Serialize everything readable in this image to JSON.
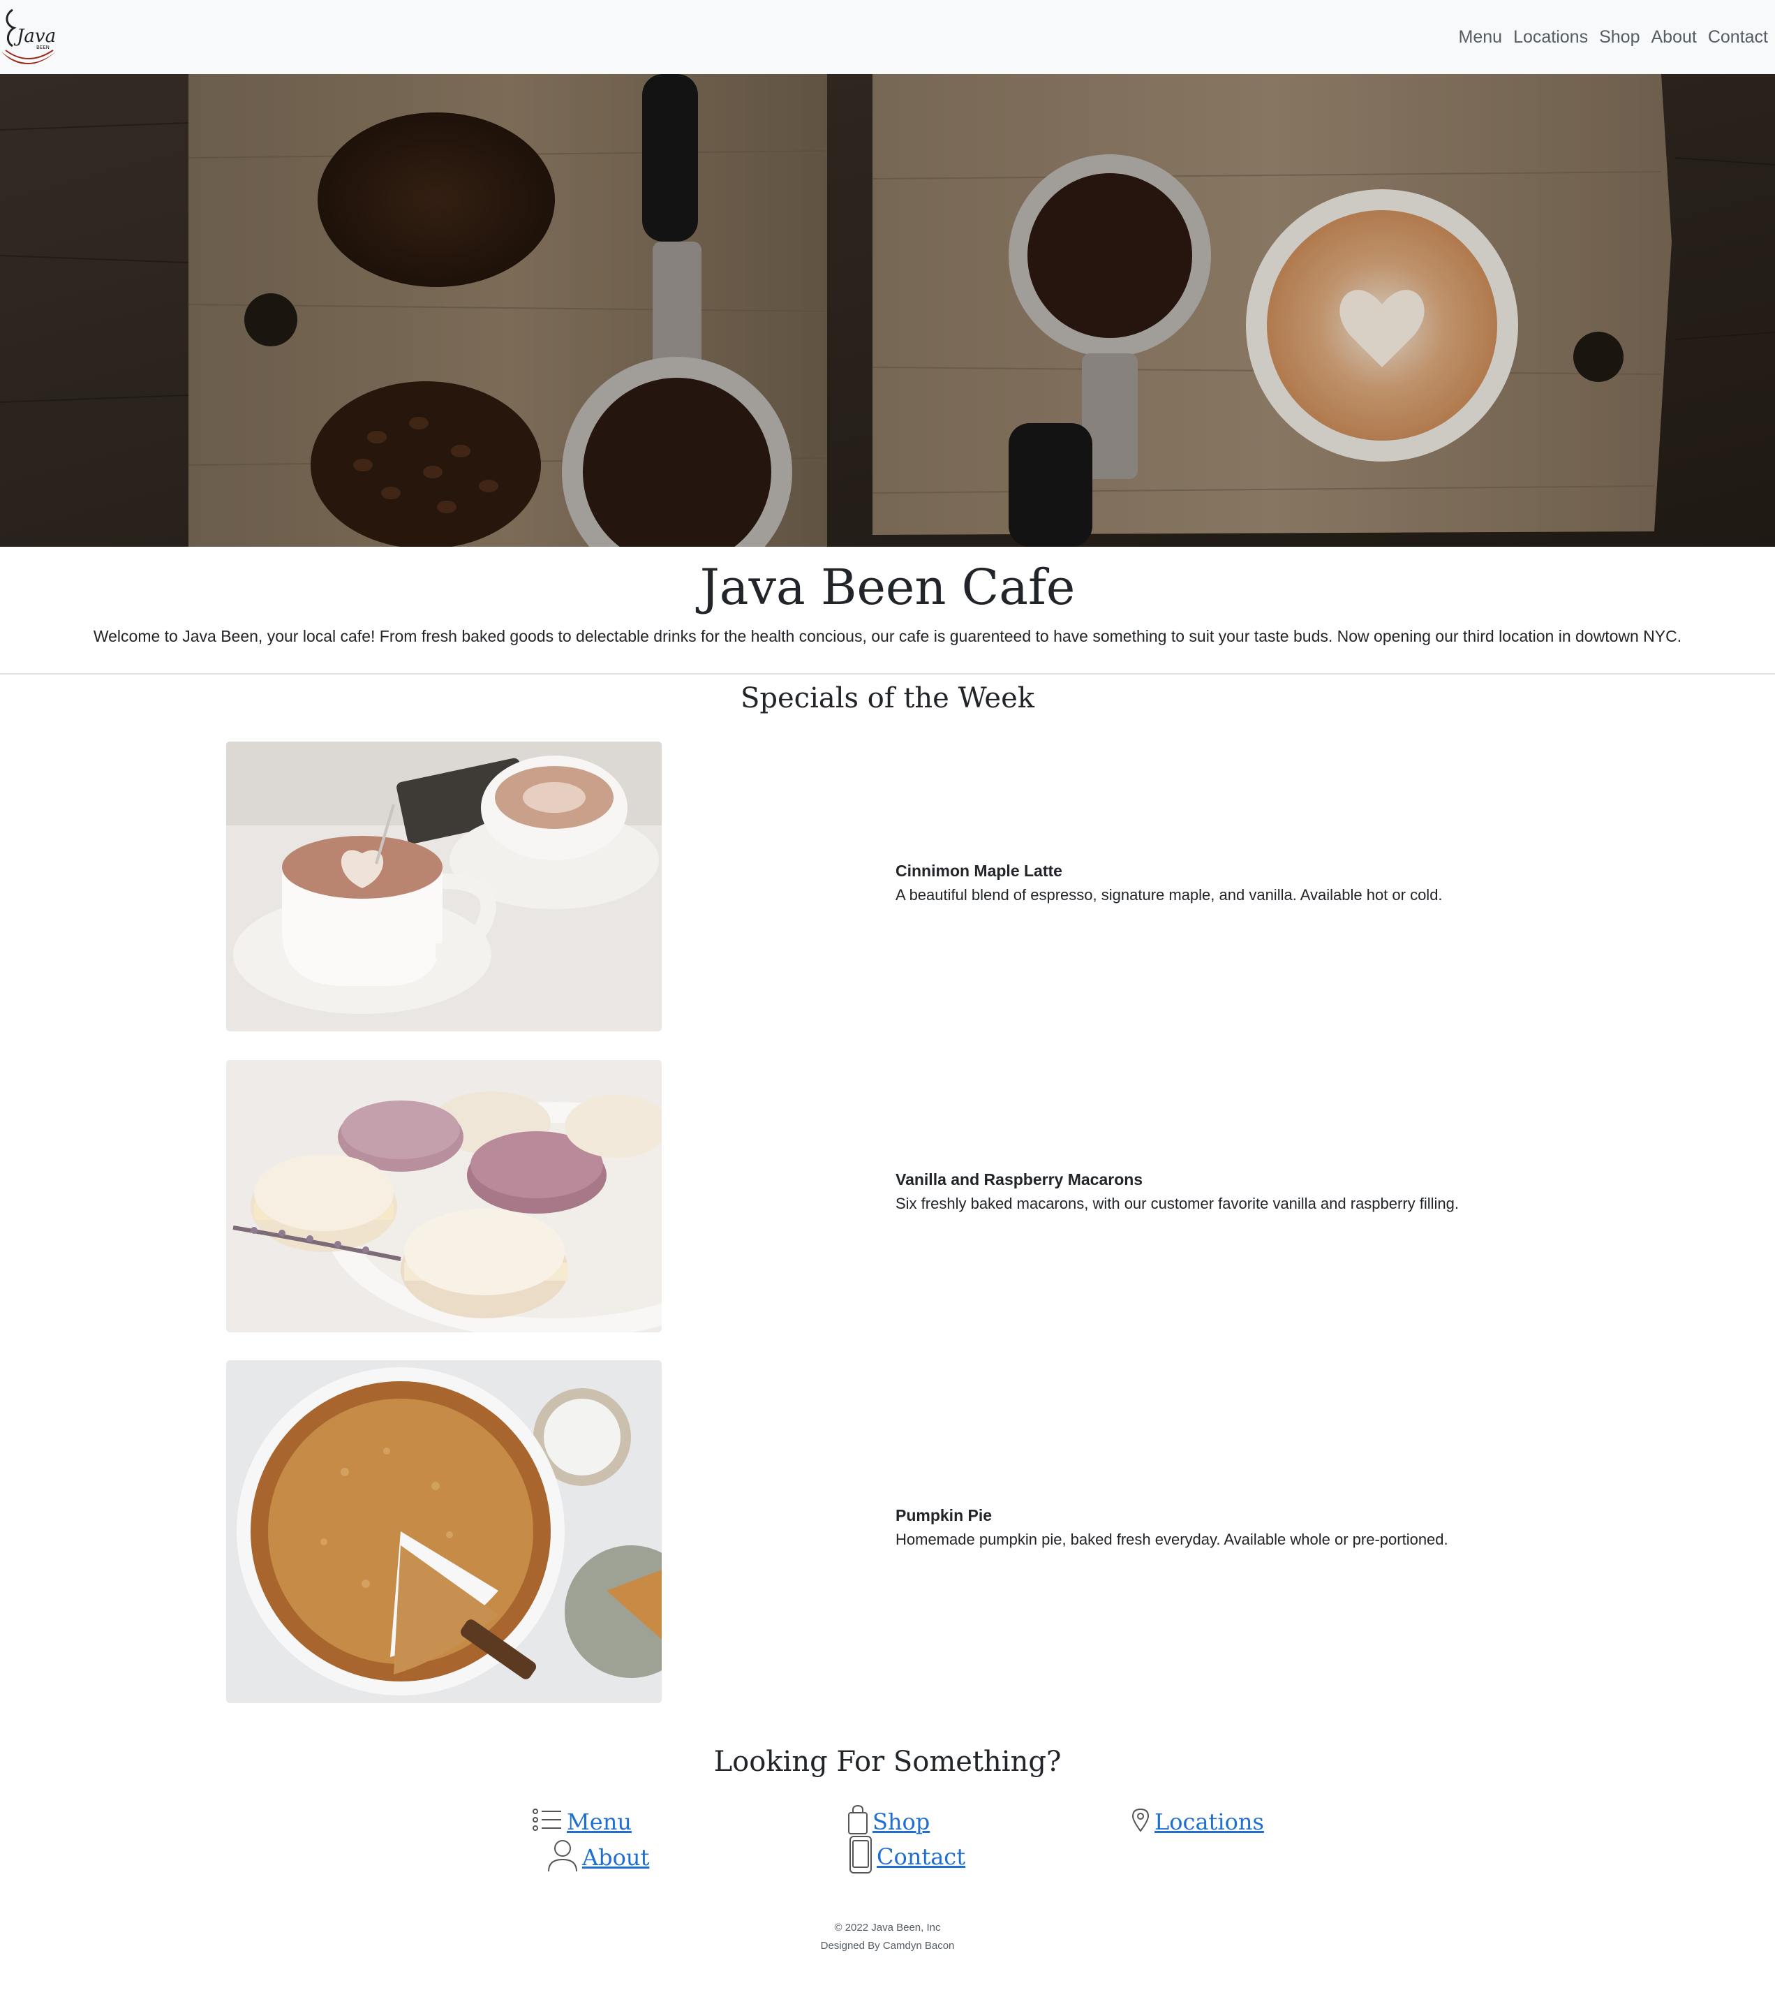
{
  "brand": {
    "logo_text": "Java",
    "logo_subtext": "BEEN",
    "colors": {
      "accent_red": "#9b2a1a",
      "link_blue": "#1f6fd1",
      "navbar_bg": "#f8f9fa"
    }
  },
  "nav": {
    "items": [
      {
        "label": "Menu"
      },
      {
        "label": "Locations"
      },
      {
        "label": "Shop"
      },
      {
        "label": "About"
      },
      {
        "label": "Contact"
      }
    ]
  },
  "intro": {
    "title": "Java Been Cafe",
    "text": "Welcome to Java Been, your local cafe! From fresh baked goods to delectable drinks for the health concious, our cafe is guarenteed to have something to suit your taste buds. Now opening our third location in dowtown NYC."
  },
  "specials": {
    "title": "Specials of the Week",
    "items": [
      {
        "name": "Cinnimon Maple Latte",
        "description": "A beautiful blend of espresso, signature maple, and vanilla. Available hot or cold."
      },
      {
        "name": "Vanilla and Raspberry Macarons",
        "description": "Six freshly baked macarons, with our customer favorite vanilla and raspberry filling."
      },
      {
        "name": "Pumpkin Pie",
        "description": "Homemade pumpkin pie, baked fresh everyday. Available whole or pre-portioned."
      }
    ]
  },
  "quick_links": {
    "title": "Looking For Something?",
    "items": [
      {
        "label": "Menu",
        "icon": "list-icon"
      },
      {
        "label": "Shop",
        "icon": "shopping-bag-icon"
      },
      {
        "label": "Locations",
        "icon": "map-pin-icon"
      },
      {
        "label": "About",
        "icon": "person-icon"
      },
      {
        "label": "Contact",
        "icon": "phone-icon"
      }
    ]
  },
  "footer": {
    "copyright": "© 2022 Java Been, Inc",
    "credit": "Designed By Camdyn Bacon"
  }
}
